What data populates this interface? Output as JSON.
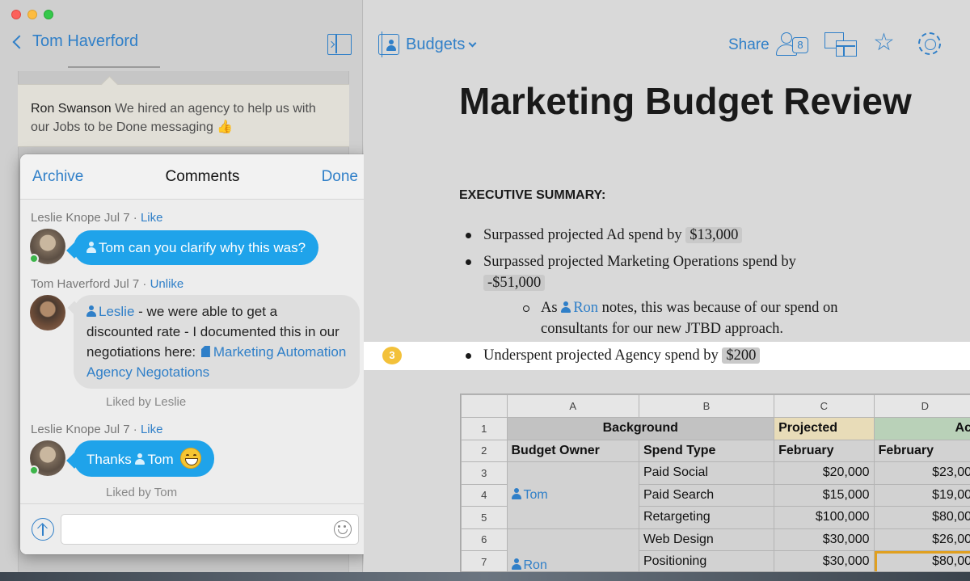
{
  "left": {
    "back_label": "Tom Haverford",
    "ron_message": {
      "author": "Ron Swanson",
      "text": "We hired an agency to help us with our Jobs to be Done messaging",
      "emoji": "👍"
    }
  },
  "comments": {
    "header": {
      "archive": "Archive",
      "title": "Comments",
      "done": "Done"
    },
    "items": [
      {
        "author": "Leslie Knope",
        "date": "Jul 7",
        "action": "Like",
        "mention": "Tom",
        "text": "can you clarify why this was?"
      },
      {
        "author": "Tom Haverford",
        "date": "Jul 7",
        "action": "Unlike",
        "mention": "Leslie",
        "text": "- we were able to get a discounted rate - I documented this in our negotiations here:",
        "link": "Marketing Automation Agency Negotations",
        "liked_by": "Liked by Leslie"
      },
      {
        "author": "Leslie Knope",
        "date": "Jul 7",
        "action": "Like",
        "text": "Thanks",
        "mention": "Tom",
        "liked_by": "Liked by Tom"
      }
    ],
    "composer_placeholder": ""
  },
  "toolbar": {
    "folder": "Budgets",
    "share": "Share",
    "share_count": "8"
  },
  "doc": {
    "title": "Marketing Budget Review",
    "section": "EXECUTIVE SUMMARY:",
    "bullets": [
      {
        "text": "Surpassed projected Ad spend by",
        "amount": "$13,000"
      },
      {
        "text": "Surpassed projected Marketing Operations spend by",
        "amount": "-$51,000"
      },
      {
        "prefix": "As",
        "mention": "Ron",
        "text": "notes, this was because of our spend on consultants for our new JTBD approach."
      },
      {
        "text": "Underspent projected Agency spend by",
        "amount": "$200"
      }
    ],
    "comment_marker": "3"
  },
  "sheet": {
    "columns": [
      "A",
      "B",
      "C",
      "D"
    ],
    "row_numbers": [
      "1",
      "2",
      "3",
      "4",
      "5",
      "6",
      "7"
    ],
    "group_headers": [
      "Background",
      "Projected",
      "Ac"
    ],
    "col_headers": [
      "Budget Owner",
      "Spend Type",
      "February",
      "February"
    ],
    "rows": [
      {
        "owner": "",
        "type": "Paid Social",
        "projected": "$20,000",
        "actual": "$23,00"
      },
      {
        "owner": "Tom",
        "type": "Paid Search",
        "projected": "$15,000",
        "actual": "$19,00"
      },
      {
        "owner": "",
        "type": "Retargeting",
        "projected": "$100,000",
        "actual": "$80,00"
      },
      {
        "owner": "",
        "type": "Web Design",
        "projected": "$30,000",
        "actual": "$26,00"
      },
      {
        "owner": "Ron",
        "type": "Positioning",
        "projected": "$30,000",
        "actual": "$80,00"
      }
    ]
  }
}
